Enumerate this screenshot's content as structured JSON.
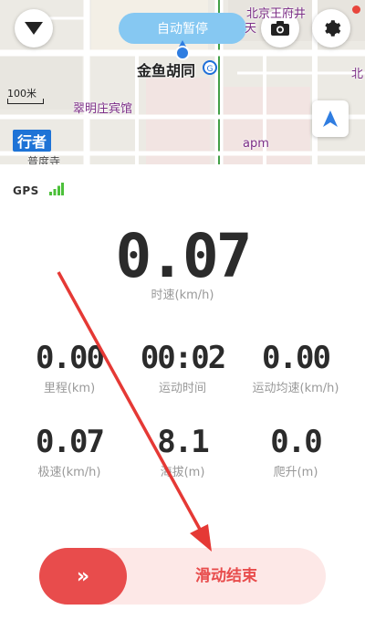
{
  "map": {
    "pause_label": "自动暂停",
    "place_labels": {
      "jinyu": "金鱼胡同",
      "cuiming": "翠明庄宾馆",
      "apm": "apm",
      "beijing_top": "北京王府井",
      "tian": "天",
      "bei_right": "北",
      "puhe": "普度寺"
    },
    "scale_label": "100米",
    "xingzhe_badge": "行者"
  },
  "panel": {
    "gps_label": "GPS",
    "speed": {
      "value": "0.07",
      "label": "时速(km/h)"
    },
    "stats": [
      {
        "value": "0.00",
        "label": "里程(km)"
      },
      {
        "value": "00:02",
        "label": "运动时间"
      },
      {
        "value": "0.00",
        "label": "运动均速(km/h)"
      },
      {
        "value": "0.07",
        "label": "极速(km/h)"
      },
      {
        "value": "8.1",
        "label": "海拔(m)"
      },
      {
        "value": "0.0",
        "label": "爬升(m)"
      }
    ],
    "slider": {
      "knob_glyph": "»",
      "label": "滑动结束"
    }
  },
  "colors": {
    "accent_red": "#e84c4c",
    "pause_blue": "#86c8f2",
    "gps_green": "#4cc03a"
  },
  "icons": [
    "dropdown-triangle-icon",
    "camera-icon",
    "gear-icon",
    "navigation-arrow-icon",
    "metro-icon",
    "signal-bars-icon",
    "double-chevron-right-icon"
  ]
}
